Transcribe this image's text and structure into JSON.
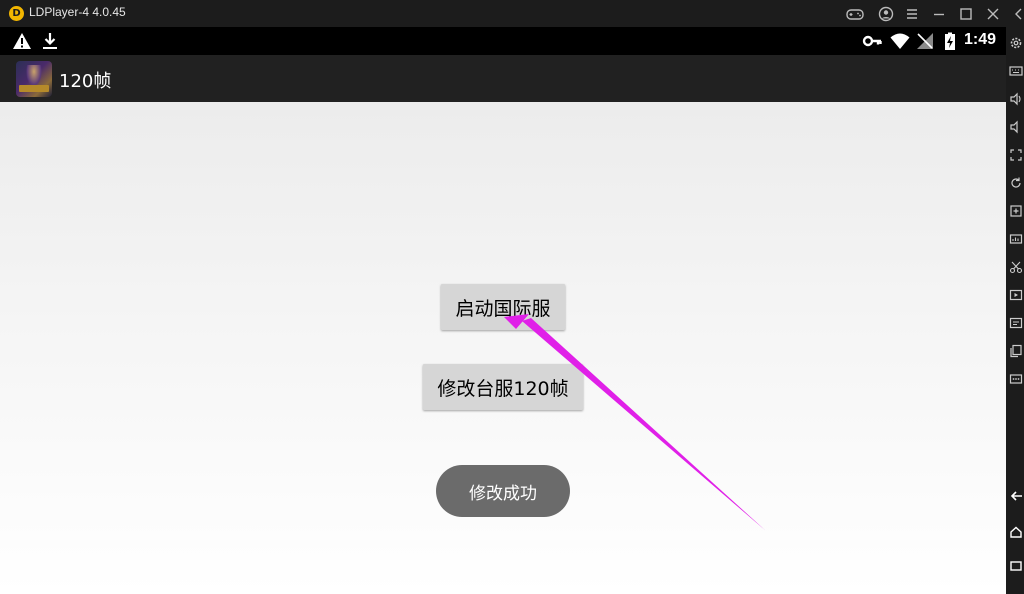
{
  "window": {
    "title": "LDPlayer-4 4.0.45",
    "controls": [
      "gamepad-icon",
      "account-icon",
      "menu-icon",
      "minimize-icon",
      "maximize-icon",
      "close-icon",
      "collapse-sidebar-icon"
    ]
  },
  "status_bar": {
    "left_icons": [
      "warning-icon",
      "download-icon"
    ],
    "right_icons": [
      "vpn-key-icon",
      "wifi-icon",
      "no-signal-icon",
      "battery-charging-icon"
    ],
    "time": "1:49"
  },
  "app_bar": {
    "title": "120帧"
  },
  "main": {
    "launch_button": "启动国际服",
    "modify_button": "修改台服120帧",
    "toast": "修改成功"
  },
  "annotation": {
    "color": "#e020e8"
  },
  "sidebar": {
    "items": [
      "settings-icon",
      "keyboard-icon",
      "volume-up-icon",
      "volume-down-icon",
      "resize-icon",
      "rotate-icon",
      "add-app-icon",
      "screenshot-icon",
      "scissors-icon",
      "record-icon",
      "sync-icon",
      "multi-window-icon",
      "more-icon",
      "back-icon",
      "home-icon",
      "recents-icon"
    ]
  }
}
